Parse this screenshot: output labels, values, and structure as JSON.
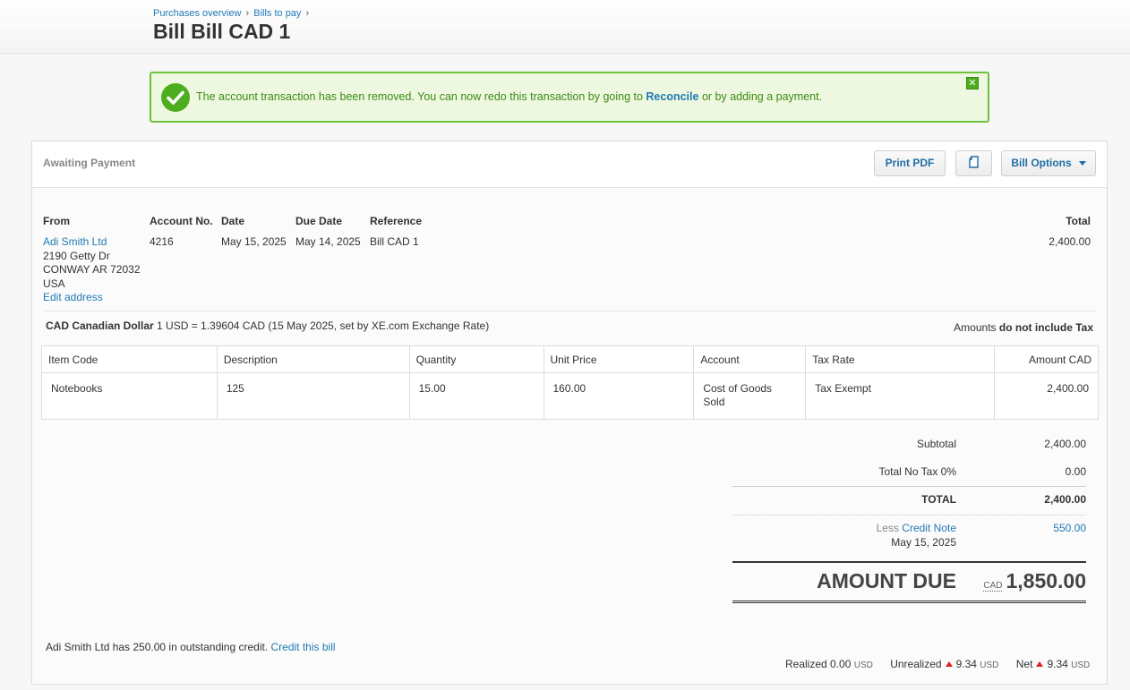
{
  "breadcrumb": {
    "item1": "Purchases overview",
    "item2": "Bills to pay",
    "sep": "›"
  },
  "title": "Bill Bill CAD 1",
  "notice": {
    "text_before": "The account transaction has been removed. You can now redo this transaction by going to ",
    "link": "Reconcile",
    "text_after": " or by adding a payment.",
    "close": "✕"
  },
  "status": "Awaiting Payment",
  "buttons": {
    "print": "Print PDF",
    "options": "Bill Options"
  },
  "info": {
    "from_label": "From",
    "account_label": "Account No.",
    "date_label": "Date",
    "due_label": "Due Date",
    "ref_label": "Reference",
    "total_label": "Total",
    "supplier": "Adi Smith Ltd",
    "addr1": "2190 Getty Dr",
    "addr2": "CONWAY AR 72032",
    "addr3": "USA",
    "edit_address": "Edit address",
    "account_no": "4216",
    "date": "May 15, 2025",
    "due_date": "May 14, 2025",
    "reference": "Bill CAD 1",
    "total": "2,400.00"
  },
  "currency": {
    "name": "CAD Canadian Dollar",
    "rate": " 1 USD = 1.39604 CAD (15 May 2025, set by XE.com Exchange Rate)"
  },
  "amounts": {
    "label": "Amounts ",
    "mode": "do not include Tax"
  },
  "table": {
    "headers": [
      "Item Code",
      "Description",
      "Quantity",
      "Unit Price",
      "Account",
      "Tax Rate",
      "Amount CAD"
    ],
    "row": [
      "Notebooks",
      "125",
      "15.00",
      "160.00",
      "Cost of Goods Sold",
      "Tax Exempt",
      "2,400.00"
    ]
  },
  "summary": {
    "subtotal_label": "Subtotal",
    "subtotal": "2,400.00",
    "tax_label": "Total No Tax 0%",
    "tax": "0.00",
    "total_label": "TOTAL",
    "total": "2,400.00",
    "less": "Less ",
    "credit_note": "Credit Note",
    "credit_date": "May 15, 2025",
    "credit_amount": "550.00",
    "due_label": "AMOUNT DUE",
    "due_cur": "CAD",
    "due": "1,850.00"
  },
  "footer": {
    "credit_text": "Adi Smith Ltd has 250.00 in outstanding credit. ",
    "credit_link": "Credit this bill",
    "realized_label": "Realized ",
    "realized": "0.00",
    "unrealized_label": "Unrealized",
    "unrealized": "9.34",
    "net_label": "Net",
    "net": "9.34",
    "usd": "USD"
  },
  "colors": {
    "accent": "#1f7ab3",
    "success": "#4cae1e",
    "loss": "#dd2222"
  }
}
